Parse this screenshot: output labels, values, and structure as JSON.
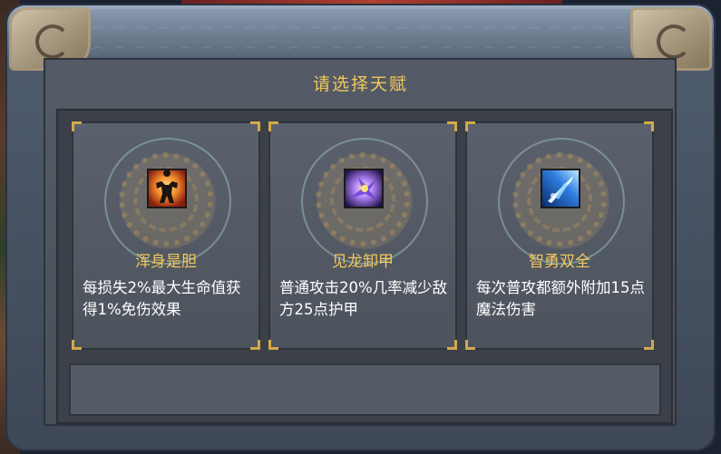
{
  "dialog": {
    "title": "请选择天赋"
  },
  "talents": [
    {
      "name": "浑身是胆",
      "description": "每损失2%最大生命值获得1%免伤效果",
      "icon": "muscle-figure-icon",
      "icon_colors": [
        "#f7b23a",
        "#c0391b"
      ]
    },
    {
      "name": "见龙卸甲",
      "description": "普通攻击20%几率减少敌方25点护甲",
      "icon": "purple-burst-icon",
      "icon_colors": [
        "#8a5cff",
        "#f0d25a"
      ]
    },
    {
      "name": "智勇双全",
      "description": "每次普攻都额外附加15点魔法伤害",
      "icon": "blue-spear-icon",
      "icon_colors": [
        "#2f7de0",
        "#bfe8ff"
      ]
    }
  ],
  "info_bar": {
    "text": ""
  },
  "theme": {
    "title_color": "#f0c75e",
    "name_color": "#f2c85a",
    "text_color": "#ffffff"
  }
}
